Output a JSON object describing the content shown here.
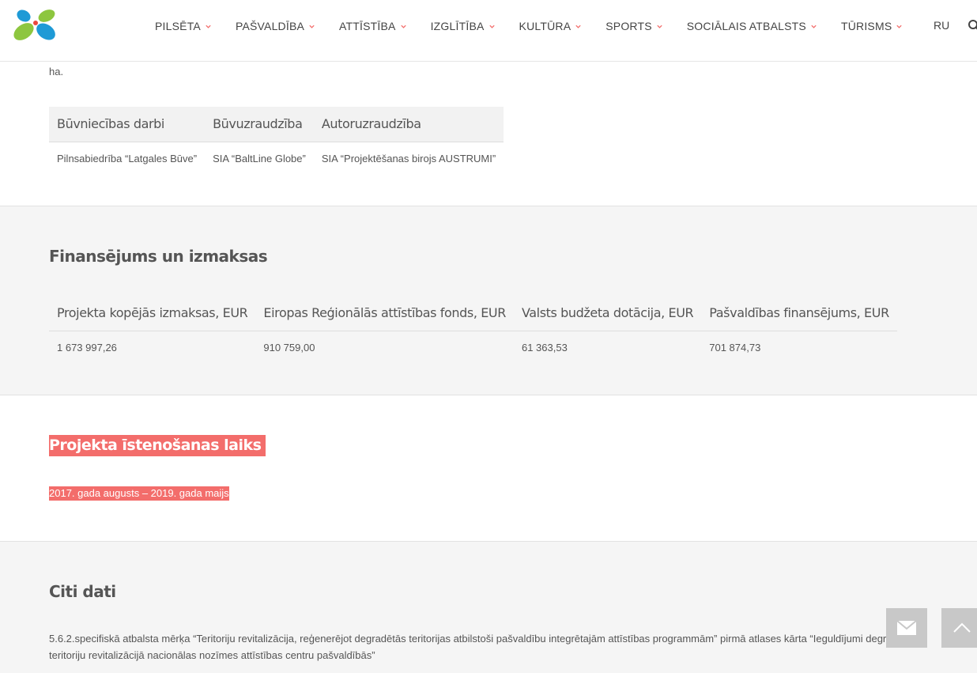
{
  "header": {
    "nav": [
      {
        "label": "PILSĒTA"
      },
      {
        "label": "PAŠVALDĪBA"
      },
      {
        "label": "ATTĪSTĪBA"
      },
      {
        "label": "IZGLĪTĪBA"
      },
      {
        "label": "KULTŪRA"
      },
      {
        "label": "SPORTS"
      },
      {
        "label": "SOCIĀLAIS ATBALSTS"
      },
      {
        "label": "TŪRISMS"
      }
    ],
    "lang": "RU",
    "colors": {
      "accent": "#f36d6b",
      "logo_green": "#8dc63f",
      "logo_blue": "#1e9ad6",
      "logo_red": "#e9473f"
    },
    "icons": [
      "logo",
      "chevron-down-icon",
      "search-icon"
    ]
  },
  "contractors": {
    "intro_text": "ha.",
    "headers": [
      "Būvniecības darbi",
      "Būvuzraudzība",
      "Autoruzraudzība"
    ],
    "row": [
      "Pilnsabiedrība “Latgales Būve”",
      "SIA “BaltLine Globe”",
      "SIA “Projektēšanas birojs AUSTRUMI”"
    ]
  },
  "finance": {
    "title": "Finansējums un izmaksas",
    "headers": [
      "Projekta kopējās izmaksas, EUR",
      "Eiropas Reģionālās attīstības fonds, EUR",
      "Valsts budžeta dotācija, EUR",
      "Pašvaldības finansējums, EUR"
    ],
    "row": [
      "1 673 997,26",
      "910 759,00",
      "61 363,53",
      "701 874,73"
    ]
  },
  "timeline": {
    "title": "Projekta īstenošanas laiks",
    "text": "2017. gada augusts – 2019. gada maijs"
  },
  "other": {
    "title": "Citi dati",
    "text": "5.6.2.specifiskā atbalsta mērķa “Teritoriju revitalizācija, reģenerējot degradētās teritorijas atbilstoši pašvaldību integrētajām attīstības programmām” pirmā atlases kārta “Ieguldījumi degradēto teritoriju revitalizācijā nacionālas nozīmes attīstības centru pašvaldībās”"
  },
  "floating": {
    "icons": [
      "mail-icon",
      "arrow-up-icon"
    ]
  }
}
